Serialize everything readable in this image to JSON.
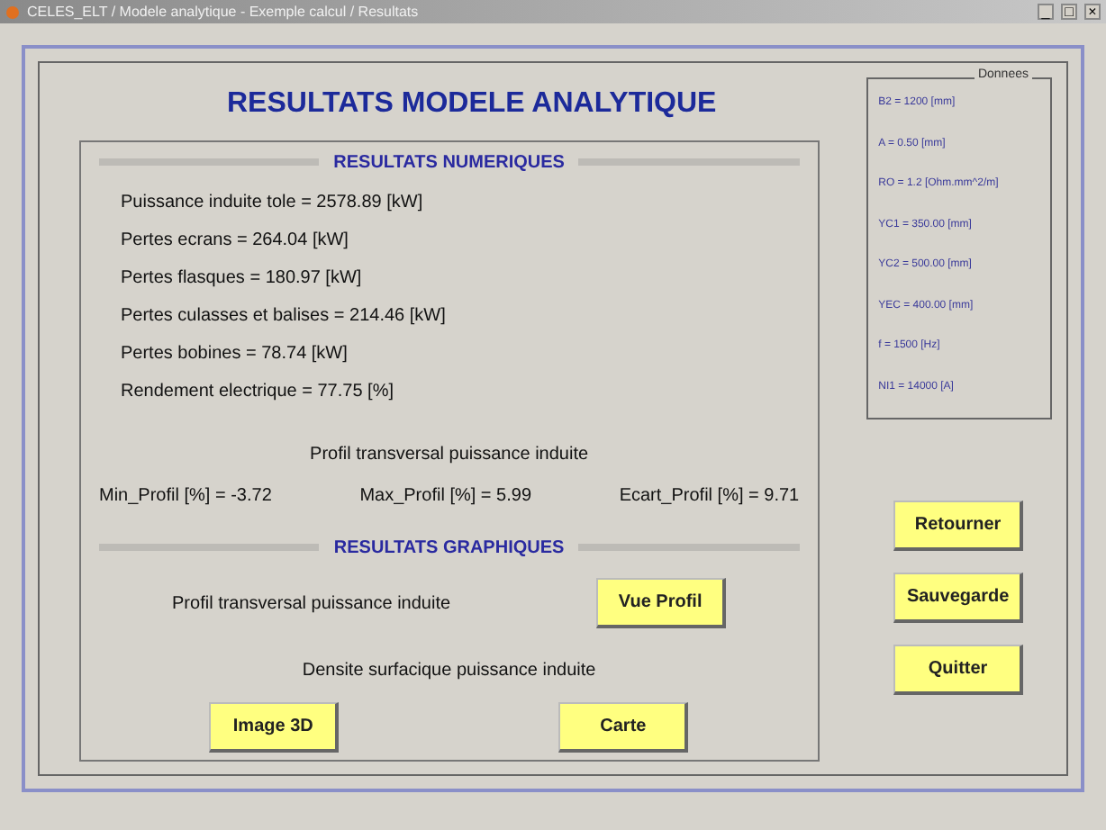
{
  "window": {
    "title": "CELES_ELT / Modele analytique - Exemple calcul / Resultats",
    "controls": [
      "_",
      "□",
      "×"
    ]
  },
  "heading": "RESULTATS MODELE ANALYTIQUE",
  "numeric": {
    "title": "RESULTATS NUMERIQUES",
    "lines": [
      "Puissance induite tole = 2578.89 [kW]",
      "Pertes ecrans = 264.04 [kW]",
      "Pertes flasques = 180.97 [kW]",
      "Pertes culasses et balises = 214.46 [kW]",
      "Pertes bobines = 78.74 [kW]",
      "Rendement electrique = 77.75 [%]"
    ]
  },
  "profile": {
    "title": "Profil transversal puissance induite",
    "values": [
      "Min_Profil [%] = -3.72",
      "Max_Profil [%] = 5.99",
      "Ecart_Profil [%] = 9.71"
    ]
  },
  "graphic": {
    "title": "RESULTATS GRAPHIQUES",
    "profile_label": "Profil transversal puissance induite",
    "profile_button": "Vue Profil",
    "density_label": "Densite surfacique puissance induite",
    "density_buttons": [
      "Image 3D",
      "Carte"
    ]
  },
  "data_panel": {
    "title": "Donnees",
    "items": [
      "B2 = 1200 [mm]",
      "A = 0.50 [mm]",
      "RO = 1.2 [Ohm.mm^2/m]",
      "YC1 = 350.00 [mm]",
      "YC2 = 500.00 [mm]",
      "YEC = 400.00 [mm]",
      "f = 1500 [Hz]",
      "NI1 = 14000 [A]"
    ]
  },
  "actions": [
    "Retourner",
    "Sauvegarde",
    "Quitter"
  ]
}
